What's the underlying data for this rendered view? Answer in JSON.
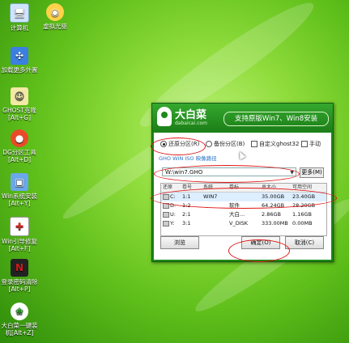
{
  "desktop_icons": [
    {
      "label": "计算机",
      "icon": "computer-icon",
      "color": "#cfe4ff"
    },
    {
      "label": "虚拟光驱",
      "icon": "disc-icon",
      "color": "#ffd24a"
    },
    {
      "label": "加载更多外置",
      "icon": "plugin-icon",
      "color": "#3b7fe0"
    },
    {
      "label": "GHOST克隆",
      "label2": "[Alt+G]",
      "icon": "ghost-icon",
      "color": "#f2e9a6"
    },
    {
      "label": "DG分区工具",
      "label2": "[Alt+D]",
      "icon": "diskgenius-icon",
      "color": "#e84b2a"
    },
    {
      "label": "Win系统安装",
      "label2": "[Alt+Y]",
      "icon": "install-icon",
      "color": "#6aa8e8"
    },
    {
      "label": "Win引导修复",
      "label2": "[Alt+F]",
      "icon": "repair-icon",
      "color": "#ffffff"
    },
    {
      "label": "登录密码清除",
      "label2": "[Alt+P]",
      "icon": "password-icon",
      "color": "#d41a1a"
    },
    {
      "label": "大白菜一键装",
      "label2": "机[Alt+Z]",
      "icon": "cabbage-icon",
      "color": "#ffffff"
    }
  ],
  "window": {
    "logo_text": "大白菜",
    "logo_sub": "dabaicai.com",
    "banner": "支持原版Win7、Win8安装",
    "options": [
      {
        "label": "还原分区(R)",
        "type": "radio",
        "checked": true
      },
      {
        "label": "备份分区(B)",
        "type": "radio",
        "checked": false
      },
      {
        "label": "自定义ghost32",
        "type": "checkbox",
        "checked": false
      },
      {
        "label": "手动",
        "type": "checkbox",
        "checked": false
      }
    ],
    "section_label": "GHO WIN ISO 映像路径",
    "path_value": "W:\\win7.GHO",
    "more_button": "更多(M)",
    "columns": [
      "还原",
      "卷号",
      "系统",
      "卷标",
      "总大小",
      "可用空间"
    ],
    "rows": [
      {
        "drive": "C:",
        "vol": "1:1",
        "sys": "WIN7",
        "label": "",
        "total": "35.00GB",
        "free": "23.40GB",
        "selected": true
      },
      {
        "drive": "D:",
        "vol": "1:2",
        "sys": "",
        "label": "软件",
        "total": "64.24GB",
        "free": "28.20GB",
        "selected": false
      },
      {
        "drive": "U:",
        "vol": "2:1",
        "sys": "",
        "label": "大白...",
        "total": "2.86GB",
        "free": "1.16GB",
        "selected": false
      },
      {
        "drive": "Y:",
        "vol": "3:1",
        "sys": "",
        "label": "V_DISK",
        "total": "333.00MB",
        "free": "0.00MB",
        "selected": false
      }
    ],
    "browse_button": "浏览",
    "ok_button": "确定(O)",
    "cancel_button": "取消(C)"
  },
  "colors": {
    "window_green": "#1e8a1a",
    "annotation_red": "#e01414",
    "link_blue": "#2a73c9"
  }
}
